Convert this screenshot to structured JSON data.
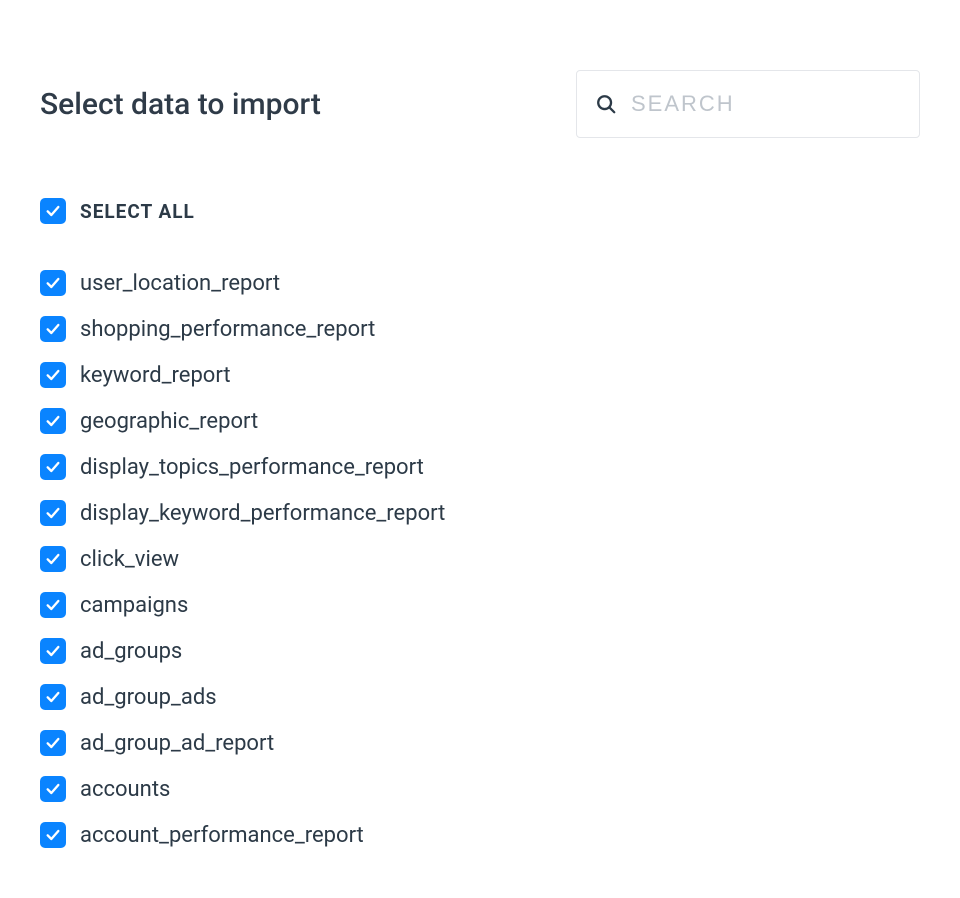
{
  "title": "Select data to import",
  "search": {
    "placeholder": "SEARCH",
    "value": ""
  },
  "select_all": {
    "label": "SELECT ALL",
    "checked": true
  },
  "items": [
    {
      "label": "user_location_report",
      "checked": true
    },
    {
      "label": "shopping_performance_report",
      "checked": true
    },
    {
      "label": "keyword_report",
      "checked": true
    },
    {
      "label": "geographic_report",
      "checked": true
    },
    {
      "label": "display_topics_performance_report",
      "checked": true
    },
    {
      "label": "display_keyword_performance_report",
      "checked": true
    },
    {
      "label": "click_view",
      "checked": true
    },
    {
      "label": "campaigns",
      "checked": true
    },
    {
      "label": "ad_groups",
      "checked": true
    },
    {
      "label": "ad_group_ads",
      "checked": true
    },
    {
      "label": "ad_group_ad_report",
      "checked": true
    },
    {
      "label": "accounts",
      "checked": true
    },
    {
      "label": "account_performance_report",
      "checked": true
    }
  ],
  "colors": {
    "accent": "#0a84ff"
  }
}
